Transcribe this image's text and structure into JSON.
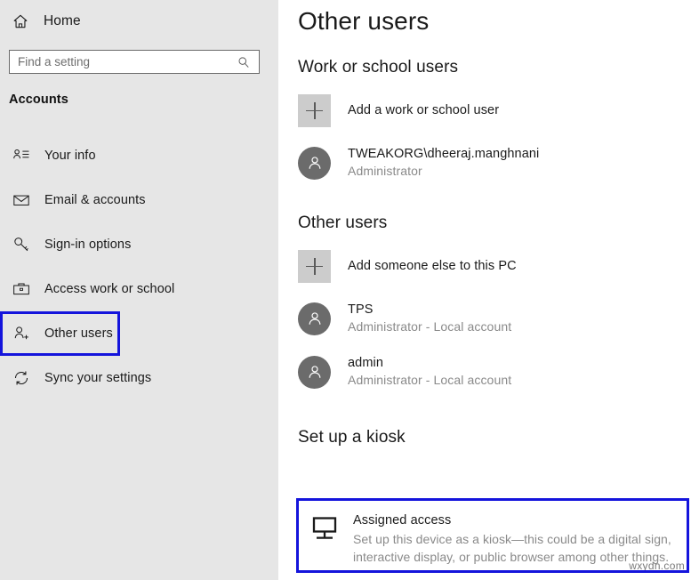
{
  "sidebar": {
    "home": {
      "label": "Home",
      "icon": "home-icon"
    },
    "search": {
      "placeholder": "Find a setting",
      "value": "",
      "icon": "search-icon"
    },
    "category_label": "Accounts",
    "items": [
      {
        "label": "Your info",
        "icon": "person-card-icon",
        "selected": false
      },
      {
        "label": "Email & accounts",
        "icon": "envelope-icon",
        "selected": false
      },
      {
        "label": "Sign-in options",
        "icon": "key-icon",
        "selected": false
      },
      {
        "label": "Access work or school",
        "icon": "briefcase-icon",
        "selected": false
      },
      {
        "label": "Other users",
        "icon": "person-plus-icon",
        "selected": true
      },
      {
        "label": "Sync your settings",
        "icon": "sync-icon",
        "selected": false
      }
    ],
    "bg_color": "#e6e6e6",
    "highlight_color": "#1414dc"
  },
  "main": {
    "page_title": "Other users",
    "sections": [
      {
        "heading": "Work or school users",
        "add": {
          "label": "Add a work or school user",
          "icon": "plus-icon"
        },
        "users": [
          {
            "name": "TWEAKORG\\dheeraj.manghnani",
            "subtitle": "Administrator",
            "icon": "avatar-person-icon"
          }
        ]
      },
      {
        "heading": "Other users",
        "add": {
          "label": "Add someone else to this PC",
          "icon": "plus-icon"
        },
        "users": [
          {
            "name": "TPS",
            "subtitle": "Administrator - Local account",
            "icon": "avatar-person-icon"
          },
          {
            "name": "admin",
            "subtitle": "Administrator - Local account",
            "icon": "avatar-person-icon"
          }
        ]
      },
      {
        "heading": "Set up a kiosk"
      }
    ],
    "kiosk": {
      "icon": "monitor-icon",
      "title": "Assigned access",
      "description": "Set up this device as a kiosk—this could be a digital sign, interactive display, or public browser among other things.",
      "highlight_color": "#1414dc"
    }
  },
  "watermark": {
    "text": "wxydn.com"
  }
}
